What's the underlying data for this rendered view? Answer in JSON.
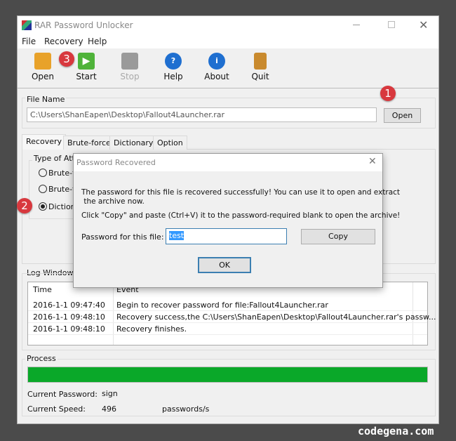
{
  "window": {
    "title": "RAR Password Unlocker",
    "icon": "app-icon",
    "controls": [
      "minimize-icon",
      "maximize-icon",
      "close-icon"
    ]
  },
  "menu": [
    "File",
    "Recovery",
    "Help"
  ],
  "toolbar": [
    {
      "label": "Open",
      "icon": "folder-open-icon",
      "color": "#e8a22a"
    },
    {
      "label": "Start",
      "icon": "play-icon",
      "color": "#4fb33a"
    },
    {
      "label": "Stop",
      "icon": "stop-icon",
      "color": "#9a9a9a"
    },
    {
      "label": "Help",
      "icon": "help-icon",
      "color": "#1f6fd0"
    },
    {
      "label": "About",
      "icon": "info-icon",
      "color": "#1f6fd0"
    },
    {
      "label": "Quit",
      "icon": "door-icon",
      "color": "#c98a2e"
    }
  ],
  "file": {
    "group_label": "File Name",
    "path": "C:\\Users\\ShanEapen\\Desktop\\Fallout4Launcher.rar",
    "open_label": "Open"
  },
  "tabs": [
    "Recovery",
    "Brute-force",
    "Dictionary",
    "Option"
  ],
  "attack": {
    "group_label": "Type of Atta",
    "options": [
      "Brute-f",
      "Brute-f",
      "Dictiona"
    ],
    "selected": 2
  },
  "badges": [
    "1",
    "2",
    "3"
  ],
  "log": {
    "label": "Log Window",
    "columns": [
      "Time",
      "Event"
    ],
    "rows": [
      [
        "2016-1-1 09:47:40",
        "Begin to recover password for file:Fallout4Launcher.rar"
      ],
      [
        "2016-1-1 09:48:10",
        "Recovery success,the C:\\Users\\ShanEapen\\Desktop\\Fallout4Launcher.rar's passw..."
      ],
      [
        "2016-1-1 09:48:10",
        "Recovery finishes."
      ]
    ]
  },
  "process": {
    "label": "Process",
    "progress_percent": 100,
    "bar_color": "#0aa829",
    "current_password_label": "Current Password:",
    "current_password": "sign",
    "current_speed_label": "Current Speed:",
    "current_speed": "496",
    "speed_unit": "passwords/s"
  },
  "dialog": {
    "title": "Password Recovered",
    "message1": "The password for this file is recovered successfully! You can use it to open and extract",
    "message1b": " the archive now.",
    "message2": "Click \"Copy\" and paste (Ctrl+V) it to the password-required blank to open the archive!",
    "password_label": "Password for this file:",
    "password": "test",
    "copy_label": "Copy",
    "ok_label": "OK"
  },
  "watermark": "codegena.com"
}
